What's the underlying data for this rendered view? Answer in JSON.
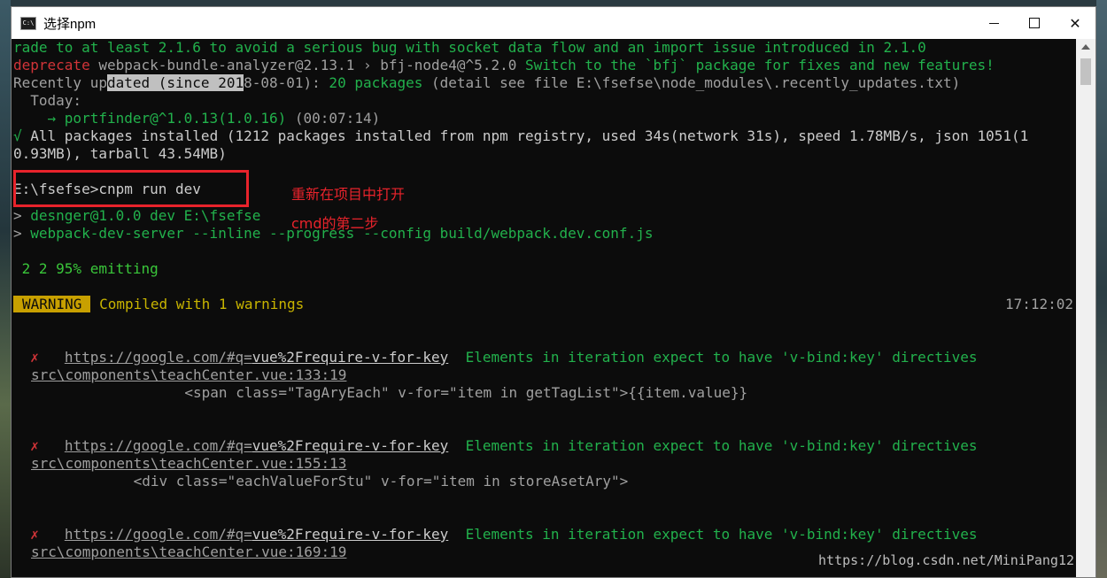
{
  "window": {
    "title": "选择npm",
    "icon_label": "C:\\"
  },
  "console": {
    "l1": "rade to at least 2.1.6 to avoid a serious bug with socket data flow and an import issue introduced in 2.1.0",
    "l2_tag": "deprecate",
    "l2_pkg": " webpack-bundle-analyzer@2.13.1 › bfj-node4@^5.2.0",
    "l2_msg": " Switch to the `bfj` package for fixes and new features!",
    "l3_a": "Recently up",
    "l3_sel_a": "dated (since 201",
    "l3_b": "8-08-01):",
    "l3_count": " 20 packages",
    "l3_detail": " (detail see file E:\\fsefse\\node_modules\\.recently_updates.txt)",
    "l4": "  Today:",
    "l5_arrow": "    → portfinder@^1.0.13",
    "l5_ver": "(1.0.16)",
    "l5_time": " (00:07:14)",
    "l6_check": "√",
    "l6_text": " All packages installed (1212 packages installed from npm registry, used 34s(network 31s), speed 1.78MB/s, json 1051(1",
    "l7": "0.93MB), tarball 43.54MB)",
    "l8_prompt": "E:\\fsefse>cnpm run dev",
    "l9_a": "> ",
    "l9_b": "desnger@1.0.0 dev E:\\fsefse",
    "l10_a": "> ",
    "l10_b": "webpack-dev-server --inline --progress --config build/webpack.dev.conf.js",
    "l11": " 2 2 95% emitting",
    "warning_badge": "WARNING",
    "warning_text": " Compiled with 1 warnings",
    "warning_time": "17:12:02",
    "errors": [
      {
        "mark": "✗",
        "url_a": "https://google.com/#q=",
        "url_b": "vue%2Frequire-v-for-key",
        "msg": "Elements in iteration expect to have 'v-bind:key' directives",
        "file": "src\\components\\teachCenter.vue:133:19",
        "code": "                  <span class=\"TagAryEach\" v-for=\"item in getTagList\">{{item.value}}"
      },
      {
        "mark": "✗",
        "url_a": "https://google.com/#q=",
        "url_b": "vue%2Frequire-v-for-key",
        "msg": "Elements in iteration expect to have 'v-bind:key' directives",
        "file": "src\\components\\teachCenter.vue:155:13",
        "code": "            <div class=\"eachValueForStu\" v-for=\"item in storeAsetAry\">"
      },
      {
        "mark": "✗",
        "url_a": "https://google.com/#q=",
        "url_b": "vue%2Frequire-v-for-key",
        "msg": "Elements in iteration expect to have 'v-bind:key' directives",
        "file": "src\\components\\teachCenter.vue:169:19",
        "code": ""
      }
    ]
  },
  "annotation": {
    "line1": "重新在项目中打开",
    "line2": "cmd的第二步"
  },
  "watermark": "https://blog.csdn.net/MiniPang12",
  "colors": {
    "terminal_bg": "#0c0c0c",
    "green": "#22b14c",
    "red_annotation": "#e8232b",
    "warning_yellow": "#c8a000"
  }
}
